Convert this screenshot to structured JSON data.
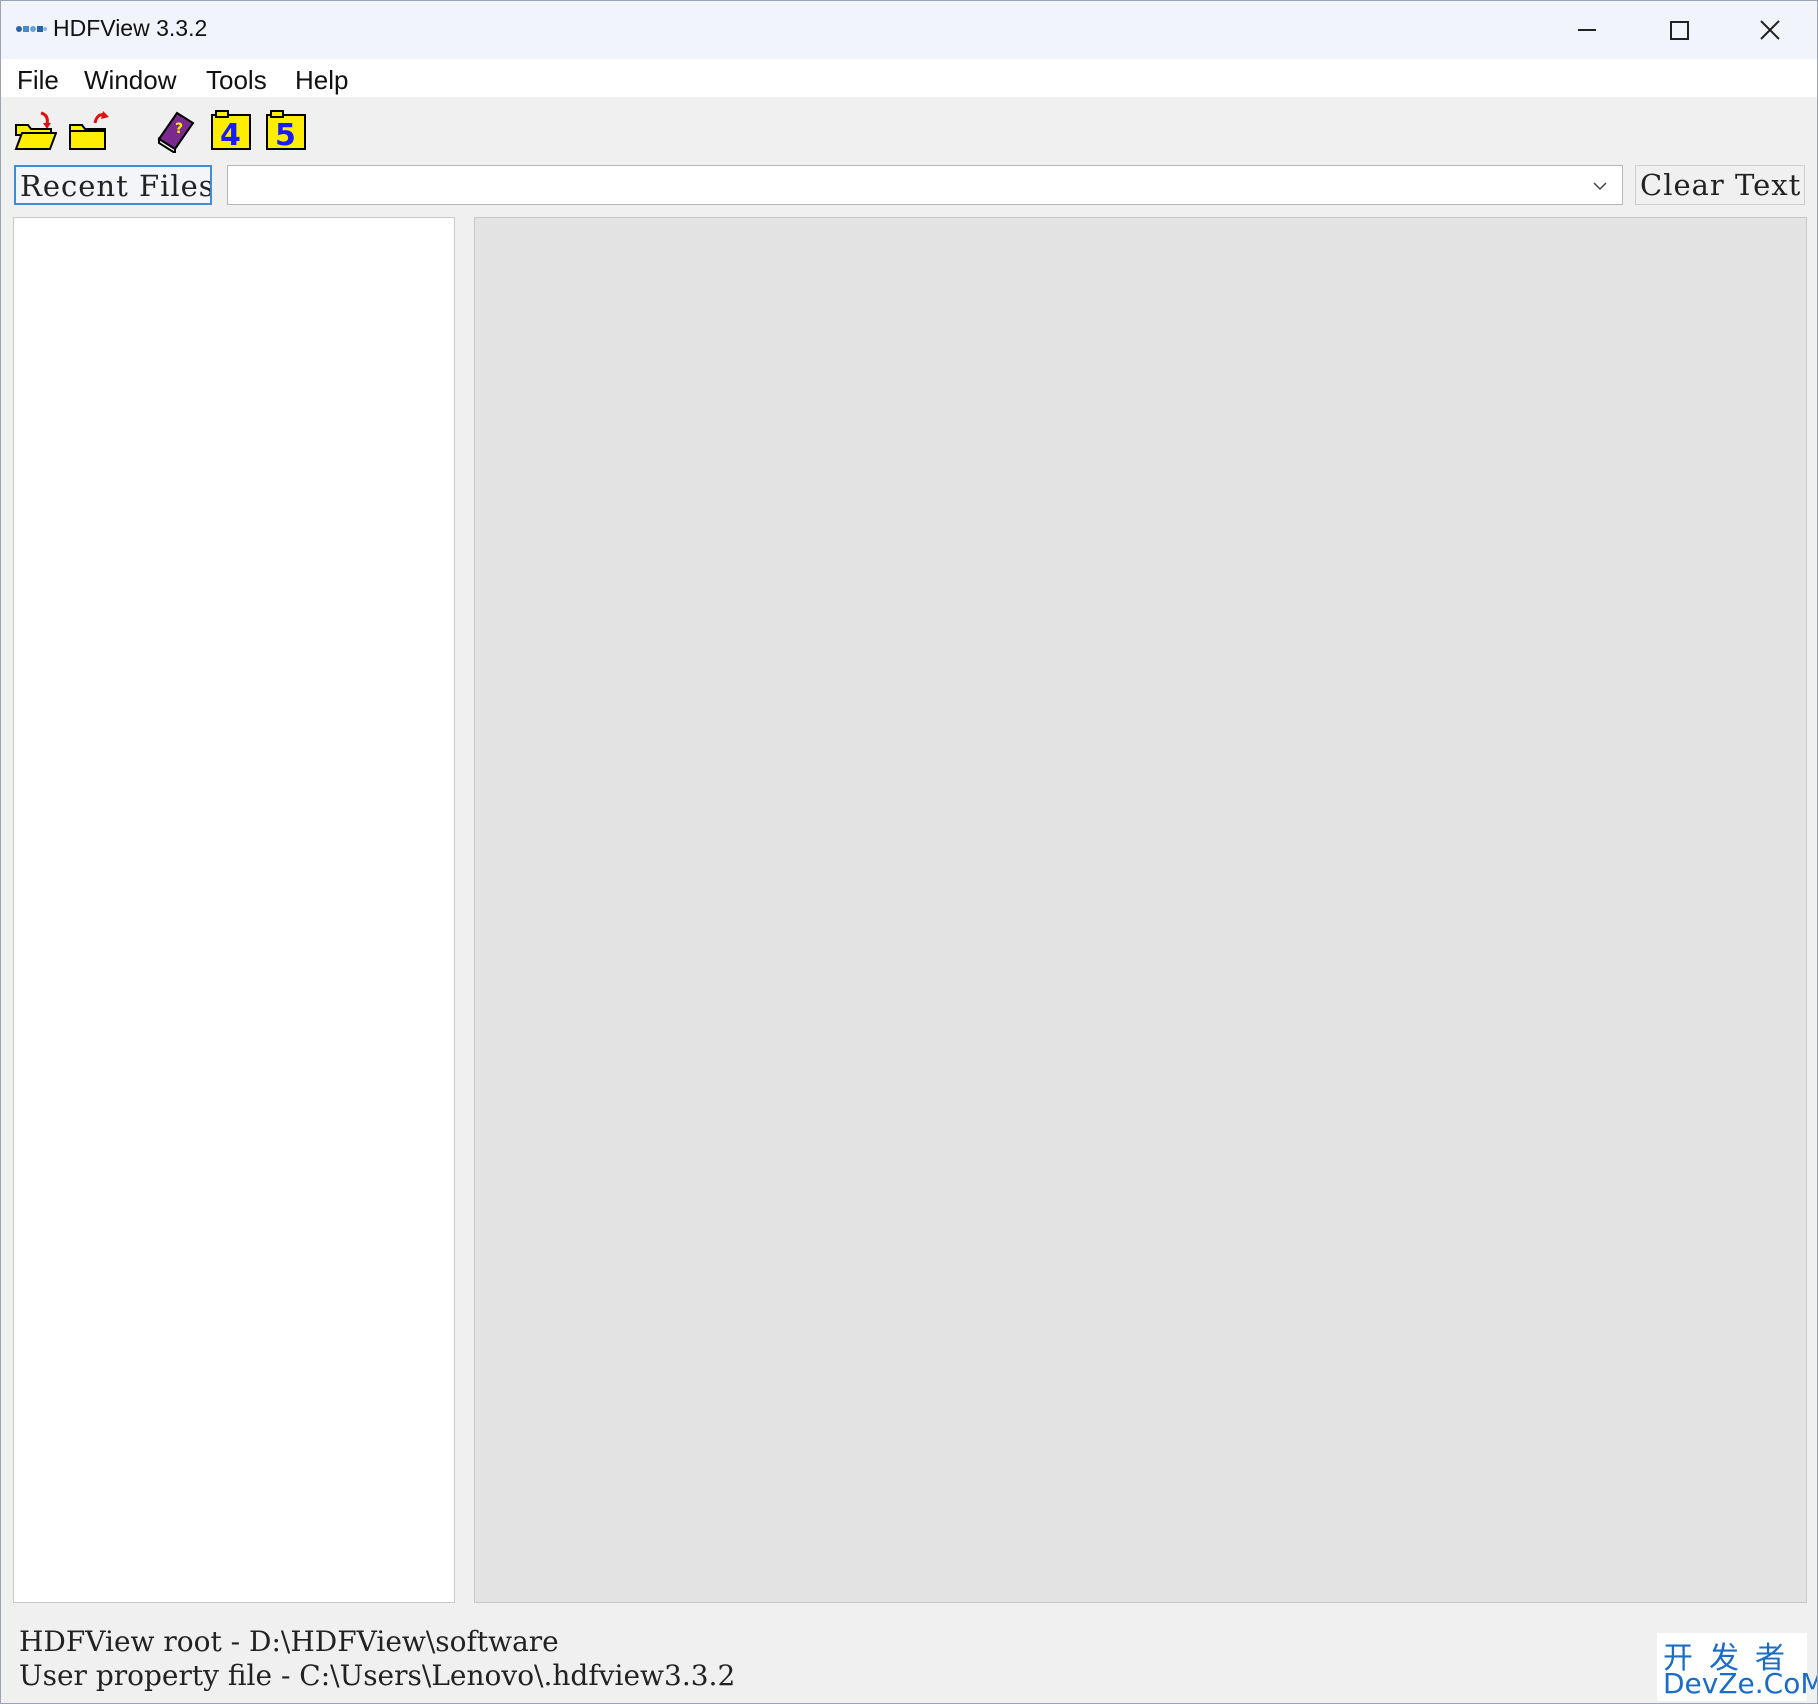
{
  "window": {
    "title": "HDFView 3.3.2"
  },
  "menubar": {
    "items": [
      {
        "label": "File"
      },
      {
        "label": "Window"
      },
      {
        "label": "Tools"
      },
      {
        "label": "Help"
      }
    ]
  },
  "toolbar": {
    "icons": [
      {
        "name": "open-file-icon"
      },
      {
        "name": "close-file-icon"
      },
      {
        "name": "help-book-icon"
      },
      {
        "name": "hdf4-library-icon",
        "text": "4"
      },
      {
        "name": "hdf5-library-icon",
        "text": "5"
      }
    ]
  },
  "recent": {
    "button_label": "Recent Files",
    "combo_value": "",
    "clear_label": "Clear Text"
  },
  "status": {
    "line1": "HDFView root - D:\\HDFView\\software",
    "line2": "User property file - C:\\Users\\Lenovo\\.hdfview3.3.2"
  },
  "watermark": {
    "cn": "开发者",
    "en": "DevZe.CoM"
  },
  "colors": {
    "accent_focus": "#3f8ed4",
    "folder_yellow": "#ffee00",
    "book_purple": "#7a2a8c",
    "library_blue": "#1a1aff",
    "watermark_blue": "#1a6cc4"
  }
}
